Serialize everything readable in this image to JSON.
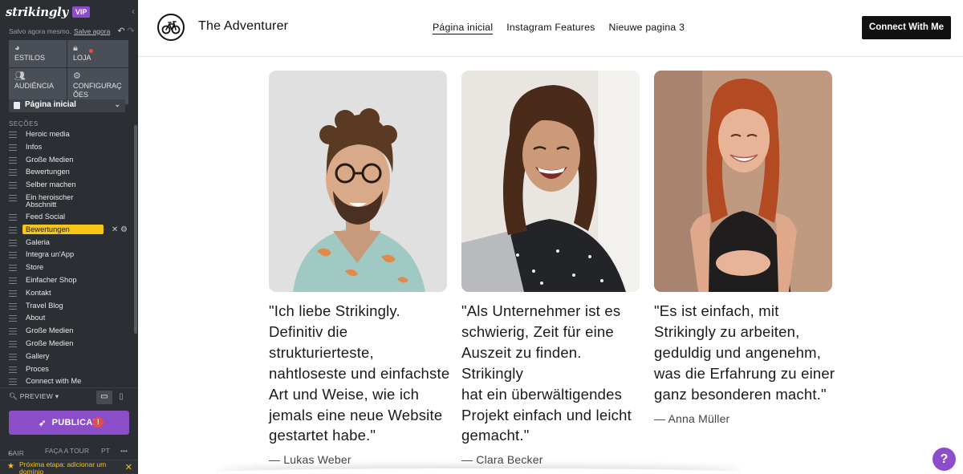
{
  "sidebar": {
    "logo": "strikingly",
    "badge": "VIP",
    "collapse_icon": "chevron-left",
    "saved_text": "Salvo agora mesmo.",
    "saved_link": "Salve agora",
    "tiles": [
      {
        "label": "ESTILOS",
        "icon": "palette"
      },
      {
        "label": "LOJA",
        "icon": "bag"
      },
      {
        "label": "AUDIÊNCIA",
        "icon": "users"
      },
      {
        "label": "CONFIGURAÇÕES",
        "icon": "gear"
      }
    ],
    "current_page": "Página inicial",
    "sections_title": "SEÇÕES",
    "sections": [
      "Heroic media",
      "Infos",
      "Große Medien",
      "Bewertungen",
      "Selber machen",
      "Ein heroischer Abschnitt",
      "Feed Social",
      "Bewertungen",
      "Galeria",
      "Integra un'App",
      "Store",
      "Einfacher Shop",
      "Kontakt",
      "Travel Blog",
      "About",
      "Große Medien",
      "Große Medien",
      "Gallery",
      "Proces",
      "Connect with Me"
    ],
    "active_section_index": 7,
    "preview": "PREVIEW",
    "publish": "PUBLICAR",
    "footer": {
      "exit": "SAIR",
      "tour": "FAÇA A TOUR",
      "lang": "PT",
      "more": "•••"
    },
    "next_step": "Próxima etapa: adicionar um domínio"
  },
  "site": {
    "title": "The Adventurer",
    "nav": [
      "Página inicial",
      "Instagram Features",
      "Nieuwe pagina 3"
    ],
    "cta": "Connect With Me",
    "testimonials": [
      {
        "lines": [
          "\"Ich liebe Strikingly.",
          "Definitiv die",
          "strukturierteste,",
          "nahtloseste und einfachste",
          "Art und Weise, wie ich",
          "jemals eine neue Website",
          "gestartet habe.\""
        ],
        "author": "— Lukas Weber"
      },
      {
        "lines": [
          "\"Als Unternehmer ist es",
          "schwierig, Zeit für eine",
          "Auszeit zu finden. Strikingly",
          "hat ein überwältigendes",
          "Projekt einfach und leicht",
          "gemacht.\""
        ],
        "author": "— Clara Becker"
      },
      {
        "lines": [
          "\"Es ist einfach, mit",
          "Strikingly zu arbeiten,",
          "geduldig und angenehm,",
          "was die Erfahrung zu einer",
          "ganz besonderen macht.\""
        ],
        "author": "— Anna Müller"
      }
    ],
    "help": "?"
  }
}
